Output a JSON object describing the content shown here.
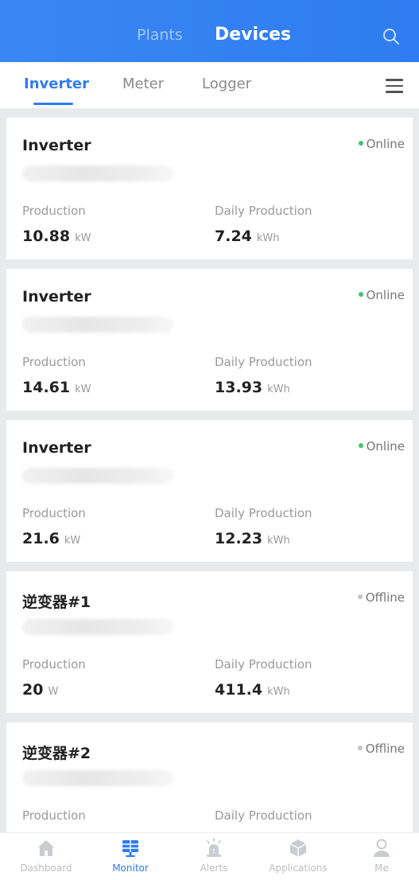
{
  "header": {
    "tab_plants": "Plants",
    "tab_devices": "Devices"
  },
  "subtabs": {
    "items": [
      "Inverter",
      "Meter",
      "Logger"
    ],
    "active": "Inverter"
  },
  "devices": [
    {
      "name": "Inverter",
      "status": "Online",
      "production_label": "Production",
      "production_value": "10.88",
      "production_unit": "kW",
      "daily_label": "Daily Production",
      "daily_value": "7.24",
      "daily_unit": "kWh"
    },
    {
      "name": "Inverter",
      "status": "Online",
      "production_label": "Production",
      "production_value": "14.61",
      "production_unit": "kW",
      "daily_label": "Daily Production",
      "daily_value": "13.93",
      "daily_unit": "kWh"
    },
    {
      "name": "Inverter",
      "status": "Online",
      "production_label": "Production",
      "production_value": "21.6",
      "production_unit": "kW",
      "daily_label": "Daily Production",
      "daily_value": "12.23",
      "daily_unit": "kWh"
    },
    {
      "name": "逆变器#1",
      "status": "Offline",
      "production_label": "Production",
      "production_value": "20",
      "production_unit": "W",
      "daily_label": "Daily Production",
      "daily_value": "411.4",
      "daily_unit": "kWh"
    },
    {
      "name": "逆变器#2",
      "status": "Offline",
      "production_label": "Production",
      "production_value": "",
      "production_unit": "",
      "daily_label": "Daily Production",
      "daily_value": "",
      "daily_unit": ""
    }
  ],
  "bottom_nav": {
    "items": [
      "Dashboard",
      "Monitor",
      "Alerts",
      "Applications",
      "Me"
    ],
    "active": "Monitor"
  },
  "colors": {
    "accent": "#2f7cf0",
    "online": "#3cc465",
    "offline": "#c4c4c4"
  },
  "icons": {
    "search": "search-icon",
    "menu": "menu-icon",
    "dashboard": "home-icon",
    "monitor": "monitor-icon",
    "alerts": "alarm-icon",
    "applications": "cube-icon",
    "me": "user-icon"
  }
}
